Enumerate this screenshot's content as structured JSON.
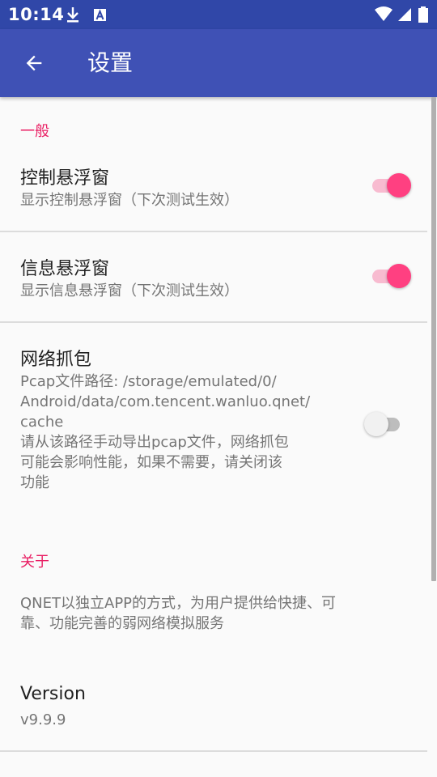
{
  "status_bar": {
    "time": "10:14",
    "icons": [
      "download-icon",
      "text-a-icon",
      "wifi-icon",
      "signal-icon",
      "battery-icon"
    ]
  },
  "app_bar": {
    "title": "设置",
    "back_icon": "arrow-left-icon"
  },
  "colors": {
    "primary": "#3f51b5",
    "primary_dark": "#3047a8",
    "accent": "#ff4081",
    "category": "#e91e63"
  },
  "sections": {
    "general": {
      "label": "一般",
      "items": [
        {
          "title": "控制悬浮窗",
          "summary": "显示控制悬浮窗（下次测试生效）",
          "enabled": true
        },
        {
          "title": "信息悬浮窗",
          "summary": "显示信息悬浮窗（下次测试生效）",
          "enabled": true
        },
        {
          "title": "网络抓包",
          "summary": "Pcap文件路径: /storage/emulated/0/\nAndroid/data/com.tencent.wanluo.qnet/\ncache\n请从该路径手动导出pcap文件，网络抓包\n可能会影响性能，如果不需要，请关闭该\n功能",
          "enabled": false
        }
      ]
    },
    "about": {
      "label": "关于",
      "description": "QNET以独立APP的方式，为用户提供给快捷、可\n靠、功能完善的弱网络模拟服务",
      "version_title": "Version",
      "version_value": "v9.9.9"
    }
  }
}
